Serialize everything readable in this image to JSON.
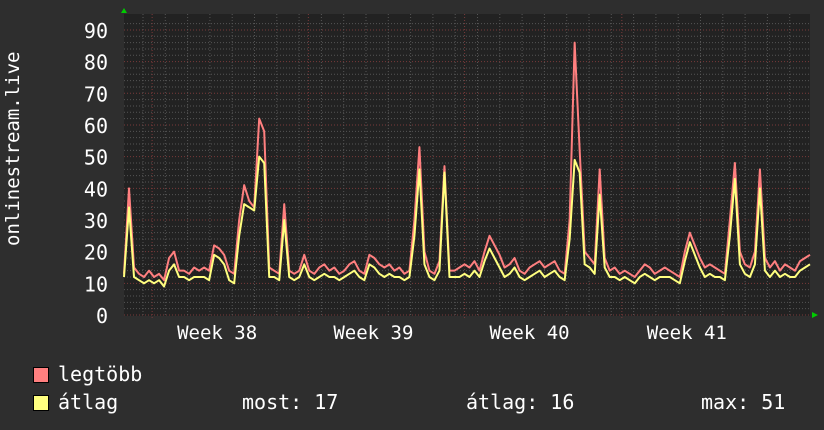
{
  "chart_data": {
    "type": "line",
    "ylabel": "onlinestream.live",
    "ylim": [
      0,
      95
    ],
    "yticks": [
      0,
      10,
      20,
      30,
      40,
      50,
      60,
      70,
      80,
      90
    ],
    "xlim": [
      0,
      137
    ],
    "xticks": [
      {
        "label": "Week 38",
        "at": 18.6
      },
      {
        "label": "Week 39",
        "at": 49.8
      },
      {
        "label": "Week 40",
        "at": 81
      },
      {
        "label": "Week 41",
        "at": 112.4
      }
    ],
    "grid": true,
    "series": [
      {
        "name": "legtöbb",
        "color": "#ff7f7f",
        "values": [
          13,
          40,
          15,
          13,
          12,
          14,
          12,
          13,
          11,
          18,
          20,
          14,
          14,
          13,
          15,
          14,
          15,
          14,
          22,
          21,
          19,
          14,
          13,
          30,
          41,
          36,
          34,
          62,
          58,
          15,
          14,
          13,
          35,
          14,
          13,
          14,
          19,
          14,
          13,
          15,
          16,
          14,
          15,
          13,
          14,
          16,
          17,
          14,
          13,
          19,
          18,
          16,
          15,
          16,
          14,
          15,
          13,
          14,
          30,
          53,
          20,
          14,
          13,
          17,
          47,
          14,
          14,
          15,
          16,
          15,
          17,
          14,
          20,
          25,
          22,
          19,
          15,
          16,
          18,
          14,
          13,
          15,
          16,
          17,
          15,
          16,
          17,
          14,
          13,
          30,
          86,
          52,
          20,
          18,
          16,
          46,
          18,
          14,
          15,
          13,
          14,
          13,
          12,
          14,
          16,
          15,
          13,
          14,
          15,
          14,
          13,
          12,
          20,
          26,
          22,
          18,
          15,
          16,
          15,
          14,
          13,
          30,
          48,
          20,
          16,
          15,
          20,
          46,
          18,
          15,
          17,
          14,
          16,
          15,
          14,
          17,
          18,
          19
        ]
      },
      {
        "name": "átlag",
        "color": "#ffff7f",
        "values": [
          12,
          34,
          12,
          11,
          10,
          11,
          10,
          11,
          9,
          14,
          16,
          12,
          12,
          11,
          12,
          12,
          12,
          11,
          19,
          18,
          16,
          11,
          10,
          25,
          35,
          34,
          33,
          50,
          48,
          12,
          12,
          11,
          30,
          12,
          11,
          12,
          16,
          12,
          11,
          12,
          13,
          12,
          12,
          11,
          12,
          13,
          14,
          12,
          11,
          16,
          15,
          13,
          12,
          13,
          12,
          12,
          11,
          12,
          25,
          46,
          16,
          12,
          11,
          14,
          45,
          12,
          12,
          12,
          13,
          12,
          14,
          12,
          17,
          21,
          18,
          15,
          12,
          13,
          15,
          12,
          11,
          12,
          13,
          14,
          12,
          13,
          14,
          12,
          11,
          24,
          49,
          45,
          16,
          15,
          13,
          38,
          15,
          12,
          12,
          11,
          12,
          11,
          10,
          12,
          13,
          12,
          11,
          12,
          12,
          12,
          11,
          10,
          17,
          23,
          19,
          15,
          12,
          13,
          12,
          12,
          11,
          25,
          43,
          16,
          13,
          12,
          16,
          40,
          14,
          12,
          14,
          12,
          13,
          12,
          12,
          14,
          15,
          16
        ]
      }
    ]
  },
  "legend": {
    "items": [
      {
        "label": "legtöbb",
        "color": "#ff7f7f"
      },
      {
        "label": "átlag",
        "color": "#ffff7f"
      }
    ],
    "stats": {
      "now": "most: 17",
      "avg": "átlag: 16",
      "max": "max: 51"
    }
  }
}
